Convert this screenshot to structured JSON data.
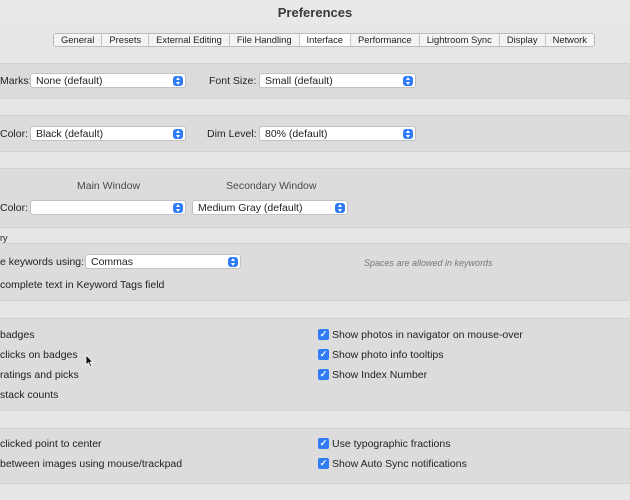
{
  "window": {
    "title": "Preferences"
  },
  "tabs": [
    {
      "label": "General",
      "active": false
    },
    {
      "label": "Presets",
      "active": false
    },
    {
      "label": "External Editing",
      "active": false
    },
    {
      "label": "File Handling",
      "active": false
    },
    {
      "label": "Interface",
      "active": true
    },
    {
      "label": "Performance",
      "active": false
    },
    {
      "label": "Lightroom Sync",
      "active": false
    },
    {
      "label": "Display",
      "active": false
    },
    {
      "label": "Network",
      "active": false
    }
  ],
  "panels": {
    "end_marks_label": "Marks:",
    "end_marks_value": "None (default)",
    "font_size_label": "Font Size:",
    "font_size_value": "Small (default)"
  },
  "lights_out": {
    "screen_color_label": "Color:",
    "screen_color_value": "Black (default)",
    "dim_level_label": "Dim Level:",
    "dim_level_value": "80% (default)"
  },
  "background": {
    "main_window_header": "Main Window",
    "secondary_window_header": "Secondary Window",
    "fill_color_label": "Color:",
    "main_window_value": "",
    "secondary_window_value": "Medium Gray (default)"
  },
  "keyword_entry": {
    "section_label": "ry",
    "separate_label": "e keywords using:",
    "separate_value": "Commas",
    "hint": "Spaces are allowed in keywords",
    "autocomplete_label": "complete text in Keyword Tags field"
  },
  "filmstrip": {
    "left_items": [
      "badges",
      "clicks on badges",
      "ratings and picks",
      "stack counts"
    ],
    "right_items": [
      {
        "label": "Show photos in navigator on mouse-over",
        "checked": true
      },
      {
        "label": "Show photo info tooltips",
        "checked": true
      },
      {
        "label": "Show Index Number",
        "checked": true
      }
    ]
  },
  "tweaks": {
    "left_items": [
      "clicked point to center",
      "between images using mouse/trackpad"
    ],
    "right_items": [
      {
        "label": "Use typographic fractions",
        "checked": true
      },
      {
        "label": "Show Auto Sync notifications",
        "checked": true
      }
    ]
  },
  "colors": {
    "accent": "#2f7cf6",
    "band": "#dcdcdc",
    "background": "#e6e6e6"
  },
  "icons": {
    "checkbox": "checkmark-icon",
    "select": "chevron-updown-icon",
    "pointer": "mouse-cursor-icon"
  }
}
